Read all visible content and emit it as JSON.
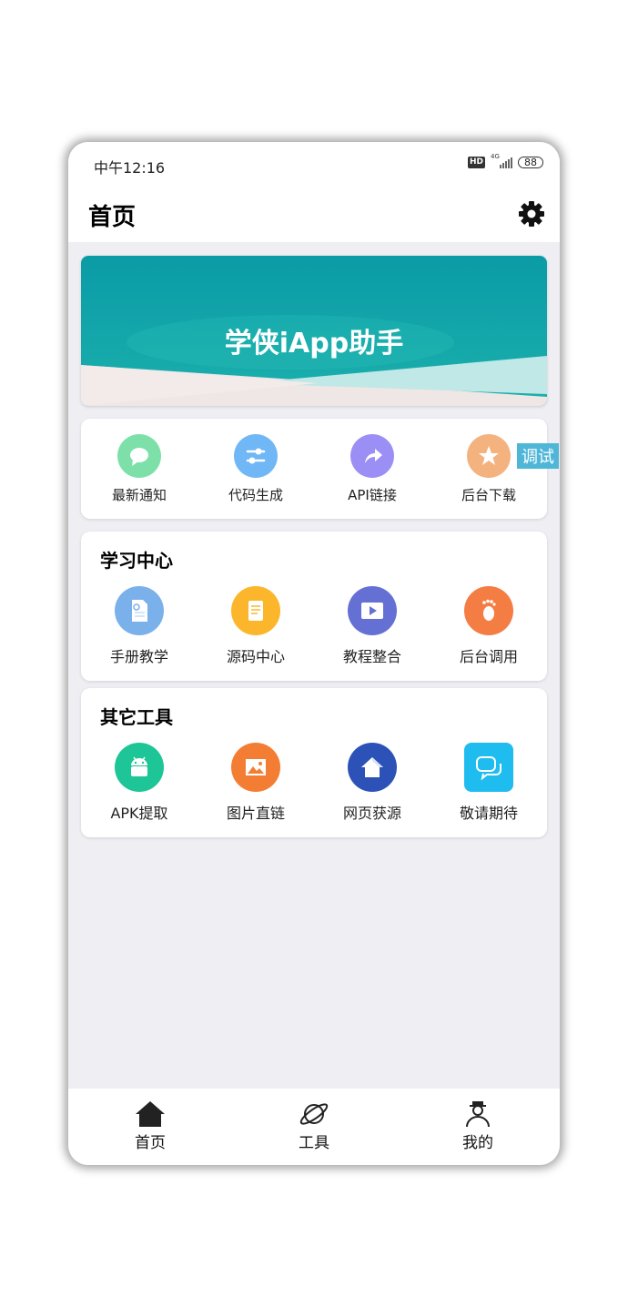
{
  "status": {
    "time": "中午12:16",
    "hd": "HD",
    "network": "4G",
    "battery": "88"
  },
  "header": {
    "title": "首页"
  },
  "banner": {
    "text": "学侠iApp助手"
  },
  "quick_actions": [
    {
      "label": "最新通知",
      "icon": "chat-bubble-icon",
      "color": "#7de0a8"
    },
    {
      "label": "代码生成",
      "icon": "sliders-icon",
      "color": "#6fb7f5"
    },
    {
      "label": "API链接",
      "icon": "share-arrow-icon",
      "color": "#9b8ff5"
    },
    {
      "label": "后台下载",
      "icon": "star-icon",
      "color": "#f4b27f"
    }
  ],
  "learning_center": {
    "title": "学习中心",
    "items": [
      {
        "label": "手册教学",
        "icon": "manual-doc-icon",
        "color": "#7ab1ea"
      },
      {
        "label": "源码中心",
        "icon": "note-icon",
        "color": "#fbb62c"
      },
      {
        "label": "教程整合",
        "icon": "video-play-icon",
        "color": "#6570d4"
      },
      {
        "label": "后台调用",
        "icon": "footprint-icon",
        "color": "#f47d44"
      }
    ]
  },
  "other_tools": {
    "title": "其它工具",
    "items": [
      {
        "label": "APK提取",
        "icon": "android-icon",
        "color": "#1ec596"
      },
      {
        "label": "图片直链",
        "icon": "image-icon",
        "color": "#f47d34"
      },
      {
        "label": "网页获源",
        "icon": "house-icon",
        "color": "#2c52b8"
      },
      {
        "label": "敬请期待",
        "icon": "chat-bubbles-icon",
        "color": "#1fbcef"
      }
    ]
  },
  "debug_label": "调试",
  "bottom_nav": [
    {
      "label": "首页",
      "icon": "home-icon"
    },
    {
      "label": "工具",
      "icon": "planet-icon"
    },
    {
      "label": "我的",
      "icon": "person-icon"
    }
  ]
}
